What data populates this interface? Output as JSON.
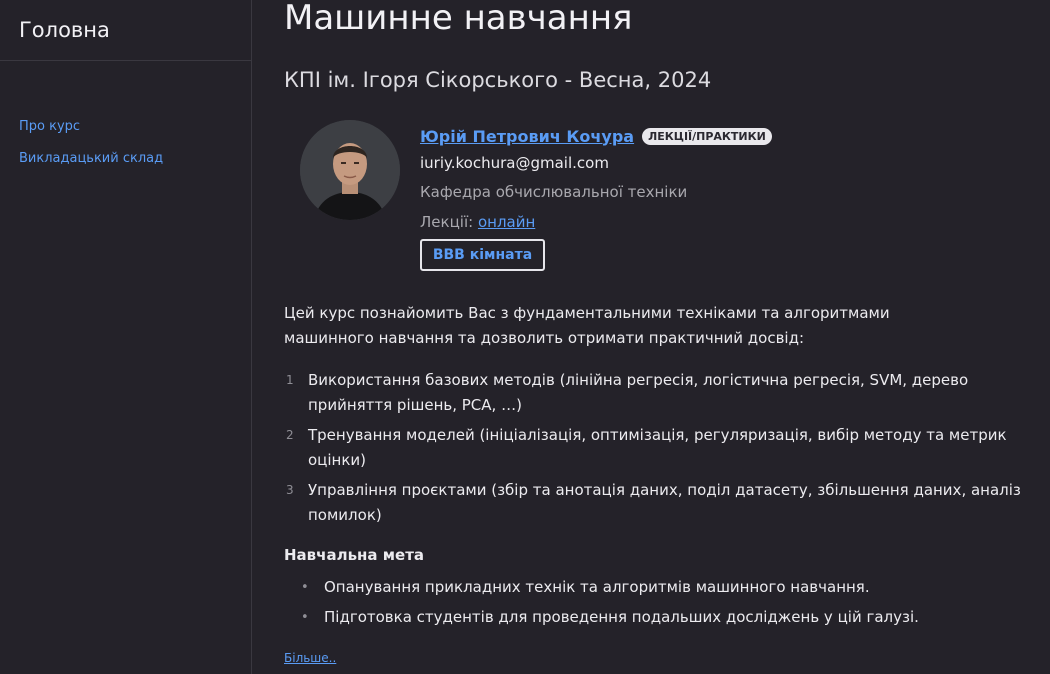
{
  "sidebar": {
    "home_label": "Головна",
    "items": [
      {
        "label": "Про курс"
      },
      {
        "label": "Викладацький склад"
      }
    ]
  },
  "main": {
    "title": "Машинне навчання",
    "subtitle": "КПІ ім. Ігоря Сікорського - Весна, 2024",
    "instructor": {
      "name": "Юрій Петрович Кочура",
      "badge": "ЛЕКЦІЇ/ПРАКТИКИ",
      "email": "iuriy.kochura@gmail.com",
      "department": "Кафедра обчислювальної техніки",
      "lectures_label": "Лекції:",
      "lectures_link": "онлайн",
      "room_button": "BBB кімната"
    },
    "description": "Цей курс познайомить Вас з фундаментальними техніками та алгоритмами машинного навчання та дозволить отримати практичний досвід:",
    "topics": [
      {
        "num": "1",
        "text": "Використання базових методів (лінійна регресія, логістична регресія, SVM, дерево прийняття рішень, PCA, …)"
      },
      {
        "num": "2",
        "text": "Тренування моделей (ініціалізація, оптимізація, регуляризація, вибір методу та метрик оцінки)"
      },
      {
        "num": "3",
        "text": "Управління проєктами (збір та анотація даних, поділ датасету, збільшення даних, аналіз помилок)"
      }
    ],
    "goal_heading": "Навчальна мета",
    "goals": [
      "Опанування прикладних технік та алгоритмів машинного навчання.",
      "Підготовка студентів для проведення подальших досліджень у цій галузі."
    ],
    "more_link": "Більше.."
  },
  "colors": {
    "background": "#242229",
    "link": "#5a9cf5",
    "text": "#ecebef",
    "muted": "#a9a8ae"
  }
}
